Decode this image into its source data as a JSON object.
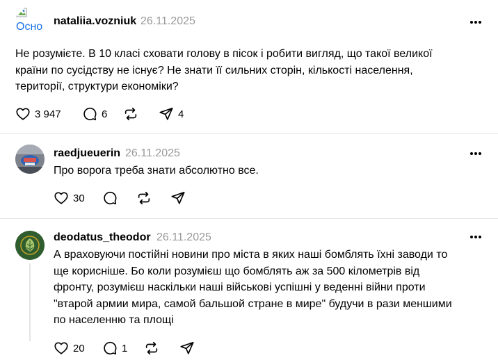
{
  "posts": [
    {
      "username": "nataliia.vozniuk",
      "date": "26.11.2025",
      "avatar_alt": "Осно",
      "text": "Не розумієте. В 10 класі сховати голову в пісок і робити вигляд, що такої великої\nкраїни по сусідству не існує? Не знати її сильних сторін, кількості населення,\nтериторії, структури економіки?",
      "likes": "3 947",
      "replies": "6",
      "reposts": "",
      "shares": "4"
    },
    {
      "username": "raedjueuerin",
      "date": "26.11.2025",
      "text": "Про ворога треба знати абсолютно все.",
      "likes": "30",
      "replies": "",
      "reposts": "",
      "shares": ""
    },
    {
      "username": "deodatus_theodor",
      "date": "26.11.2025",
      "text": "А враховуючи постійні новини про міста в яких наші бомблять їхні заводи то\nще корисніше. Бо коли розумієш що бомблять аж за 500 кілометрів від\nфронту, розумієш наскільки наші військові успішні у веденні війни проти\n\"втарой армии мира, самой бальшой стране в мире\" будучи в рази меншими\nпо населенню та площі",
      "likes": "20",
      "replies": "1",
      "reposts": "",
      "shares": ""
    }
  ],
  "icons": {
    "like": "heart-icon",
    "reply": "comment-icon",
    "repost": "repost-icon",
    "share": "share-icon",
    "more": "more-icon"
  },
  "colors": {
    "text": "#000000",
    "muted": "#999999",
    "divider": "#e5e5e5"
  }
}
